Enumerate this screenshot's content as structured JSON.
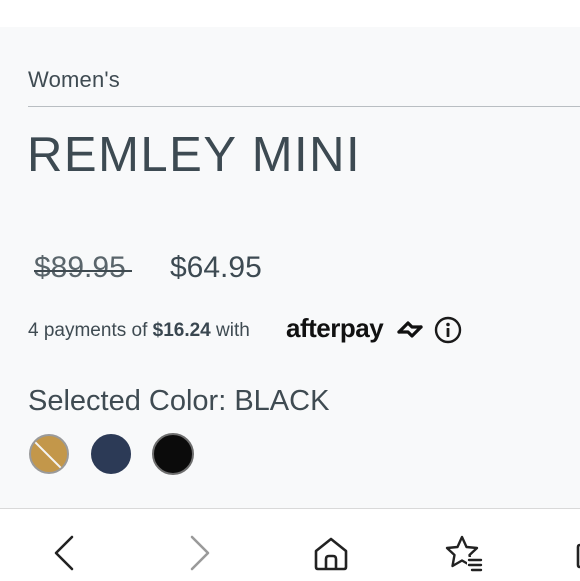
{
  "product": {
    "category": "Women's",
    "title": "REMLEY MINI",
    "price_original": "$89.95",
    "price_sale": "$64.95"
  },
  "afterpay": {
    "prefix": "4 payments of ",
    "amount": "$16.24",
    "suffix": " with",
    "brand": "afterpay"
  },
  "color": {
    "selected_label": "Selected Color: BLACK",
    "swatches": [
      {
        "name": "tan",
        "hex": "#c3974a",
        "unavailable": true
      },
      {
        "name": "navy",
        "hex": "#2c3a56",
        "unavailable": false
      },
      {
        "name": "black",
        "hex": "#0b0b0b",
        "unavailable": false,
        "selected": true
      }
    ]
  },
  "icons": {
    "info": "info-icon",
    "back": "chevron-left-icon",
    "forward": "chevron-right-icon",
    "home": "home-icon",
    "favorites": "favorites-icon",
    "tabs": "tabs-icon"
  },
  "colors": {
    "text": "#3c4a52",
    "background": "#f8f9fa"
  }
}
